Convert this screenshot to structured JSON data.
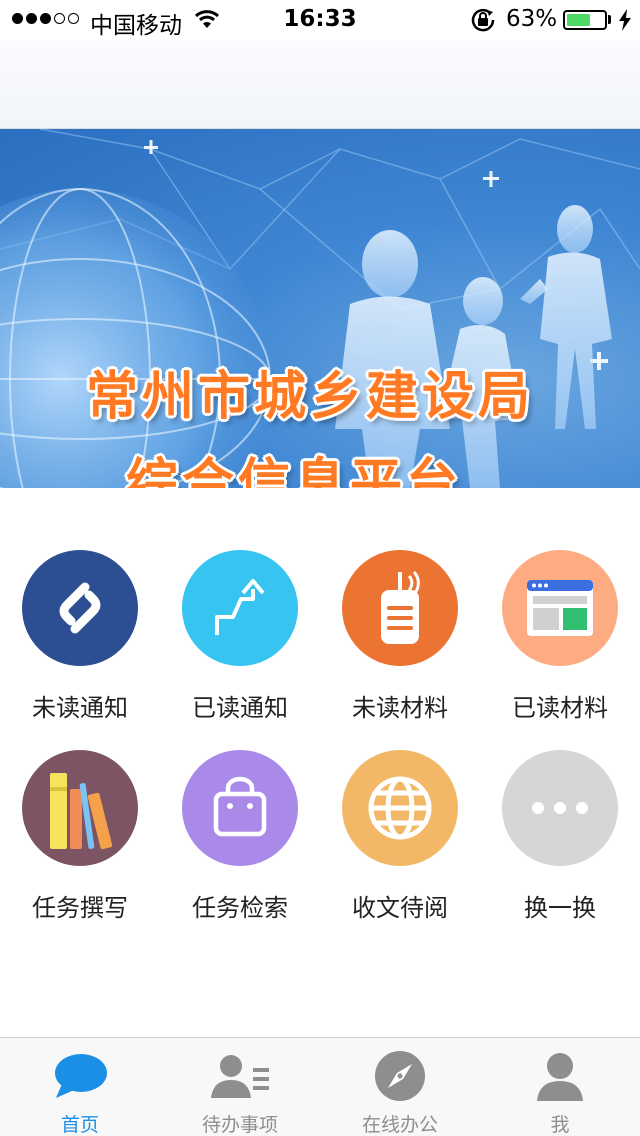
{
  "status_bar": {
    "carrier": "中国移动",
    "time": "16:33",
    "battery_percent": "63%",
    "battery_level": 0.63,
    "signal_bars_filled": 3,
    "signal_bars_total": 5
  },
  "banner": {
    "title_line1": "常州市城乡建设局",
    "title_line2": "综合信息平台"
  },
  "grid": {
    "items": [
      {
        "label": "未读通知",
        "icon": "shazam-icon",
        "color": "#2c4f93"
      },
      {
        "label": "已读通知",
        "icon": "route-arrow-icon",
        "color": "#38c4f1"
      },
      {
        "label": "未读材料",
        "icon": "walkie-talkie-icon",
        "color": "#ec7433"
      },
      {
        "label": "已读材料",
        "icon": "browser-window-icon",
        "color": "#fcab82"
      },
      {
        "label": "任务撰写",
        "icon": "books-icon",
        "color": "#7d5463"
      },
      {
        "label": "任务检索",
        "icon": "shopping-bag-icon",
        "color": "#a98ae8"
      },
      {
        "label": "收文待阅",
        "icon": "globe-icon",
        "color": "#f3b867"
      },
      {
        "label": "换一换",
        "icon": "more-dots-icon",
        "color": "#d6d6d6"
      }
    ]
  },
  "tab_bar": {
    "tabs": [
      {
        "label": "首页",
        "icon": "chat-bubble-icon",
        "active": true
      },
      {
        "label": "待办事项",
        "icon": "contacts-list-icon",
        "active": false
      },
      {
        "label": "在线办公",
        "icon": "compass-icon",
        "active": false
      },
      {
        "label": "我",
        "icon": "person-icon",
        "active": false
      }
    ],
    "active_color": "#1b8fe6",
    "inactive_color": "#8e8e8e"
  }
}
